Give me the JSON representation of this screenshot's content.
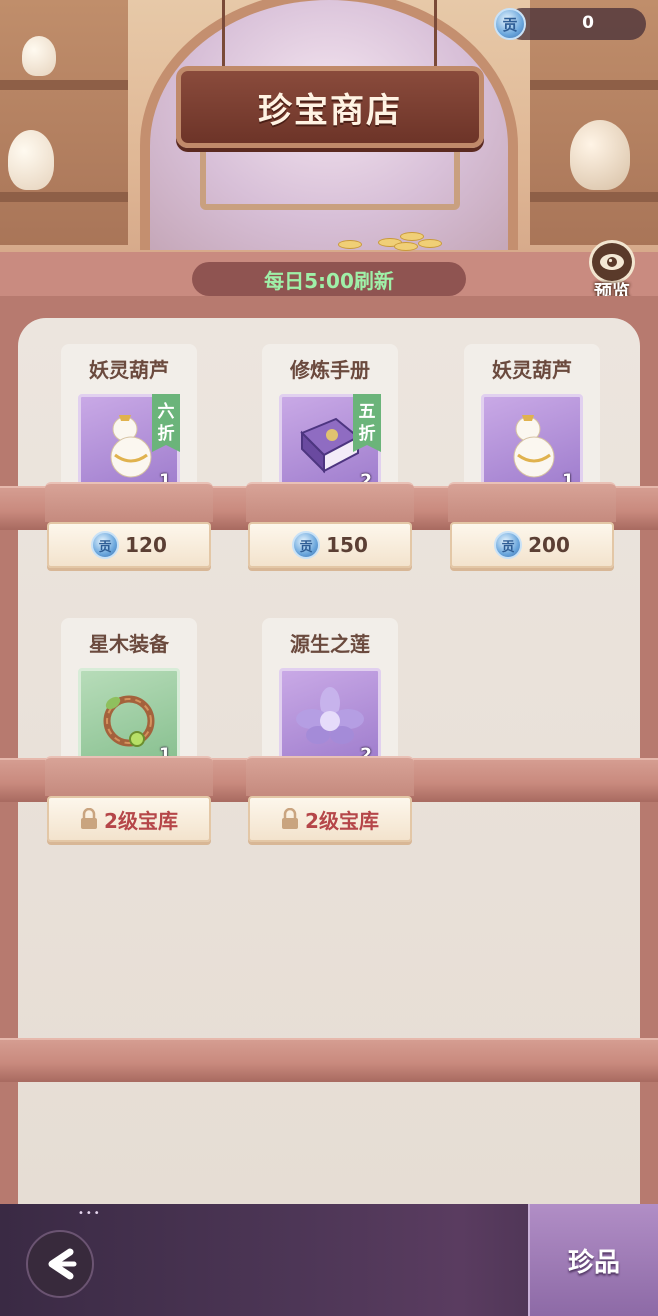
{
  "currency": {
    "icon": "tribute-coin-icon",
    "glyph": "贡",
    "amount": "0"
  },
  "shop": {
    "title": "珍宝商店",
    "refresh": "每日5:00刷新",
    "preview_label": "预览"
  },
  "items": [
    {
      "name": "妖灵葫芦",
      "icon": "gourd-icon",
      "rarity": "purple",
      "quantity": "1",
      "discount": [
        "六",
        "折"
      ],
      "price": "120",
      "locked": false
    },
    {
      "name": "修炼手册",
      "icon": "book-icon",
      "rarity": "purple",
      "quantity": "2",
      "discount": [
        "五",
        "折"
      ],
      "price": "150",
      "locked": false
    },
    {
      "name": "妖灵葫芦",
      "icon": "gourd-icon",
      "rarity": "purple",
      "quantity": "1",
      "discount": null,
      "price": "200",
      "locked": false
    },
    {
      "name": "星木装备",
      "icon": "vine-ring-icon",
      "rarity": "green",
      "quantity": "1",
      "discount": null,
      "lock_text": "2级宝库",
      "locked": true
    },
    {
      "name": "源生之莲",
      "icon": "lotus-icon",
      "rarity": "purple",
      "quantity": "2",
      "discount": null,
      "lock_text": "2级宝库",
      "locked": true
    }
  ],
  "bottom": {
    "back_icon": "back-arrow-icon",
    "tab_label": "珍品"
  },
  "colors": {
    "refresh_text": "#9ff0a8",
    "lock_text": "#b54649",
    "cabinet": "#b77a6f"
  }
}
